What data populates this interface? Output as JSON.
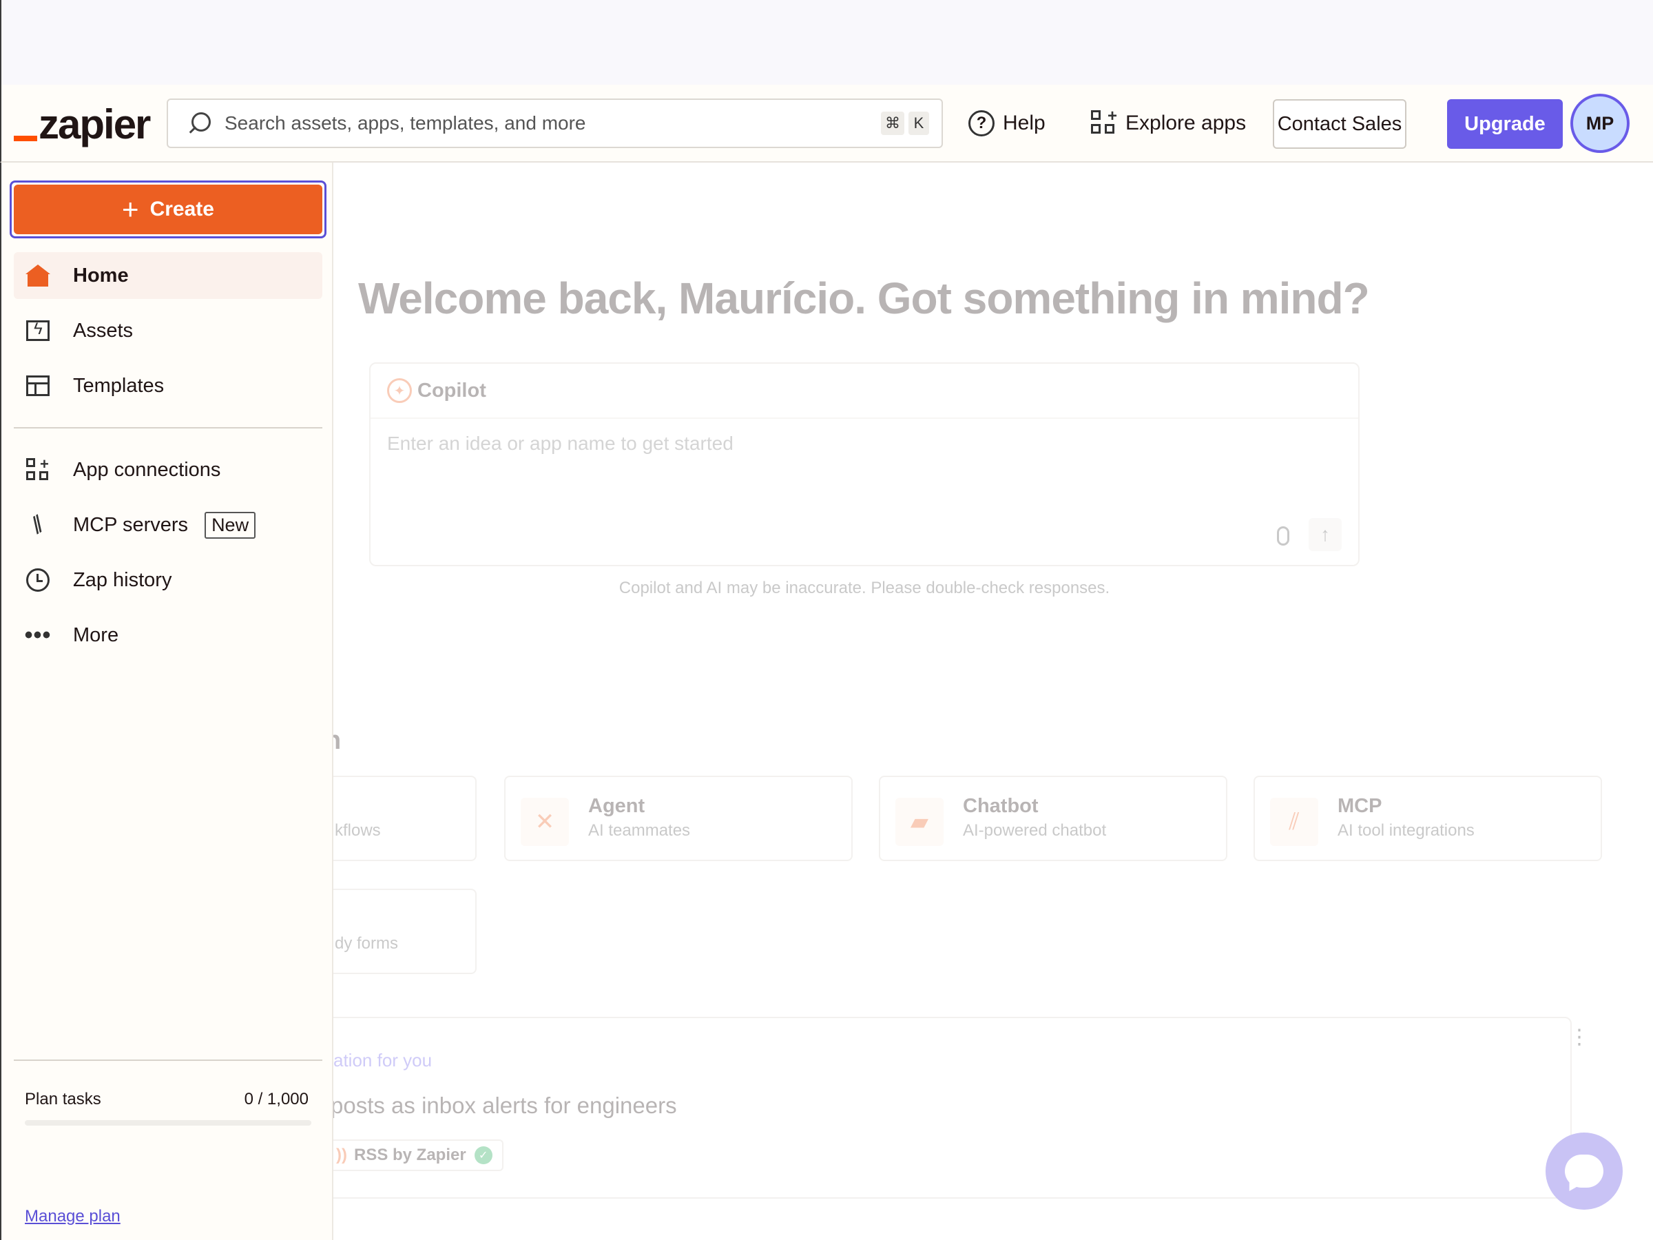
{
  "header": {
    "logo_text": "zapier",
    "search_placeholder": "Search assets, apps, templates, and more",
    "shortcut_keys": [
      "⌘",
      "K"
    ],
    "help_label": "Help",
    "explore_label": "Explore apps",
    "contact_label": "Contact Sales",
    "upgrade_label": "Upgrade",
    "avatar_initials": "MP"
  },
  "sidebar": {
    "create_label": "Create",
    "items": [
      {
        "label": "Home",
        "icon": "home-icon",
        "active": true
      },
      {
        "label": "Assets",
        "icon": "assets-icon"
      },
      {
        "label": "Templates",
        "icon": "templates-icon"
      },
      {
        "label": "App connections",
        "icon": "app-connections-icon"
      },
      {
        "label": "MCP servers",
        "icon": "mcp-icon",
        "badge": "New"
      },
      {
        "label": "Zap history",
        "icon": "clock-icon"
      },
      {
        "label": "More",
        "icon": "more-dots-icon"
      }
    ],
    "plan_label": "Plan tasks",
    "plan_value": "0 / 1,000",
    "plan_progress": 0,
    "manage_label": "Manage plan"
  },
  "main": {
    "welcome": "Welcome back, Maurício. Got something in mind?",
    "copilot_title": "Copilot",
    "copilot_placeholder": "Enter an idea or app name to get started",
    "disclaimer": "Copilot and AI may be inaccurate. Please double-check responses.",
    "section_heading_partial": "h",
    "tiles": [
      {
        "title": "",
        "subtitle": "kflows"
      },
      {
        "title": "Agent",
        "subtitle": "AI teammates"
      },
      {
        "title": "Chatbot",
        "subtitle": "AI-powered chatbot"
      },
      {
        "title": "MCP",
        "subtitle": "AI tool integrations"
      },
      {
        "title": "",
        "subtitle": "dy forms"
      }
    ],
    "recommendation_label": "ation for you",
    "recommendation_title": "posts as inbox alerts for engineers",
    "recommendation_chip": "RSS by Zapier"
  },
  "colors": {
    "brand_orange": "#ec5f22",
    "accent_purple": "#695be8",
    "avatar_bg": "#c9dcff"
  }
}
